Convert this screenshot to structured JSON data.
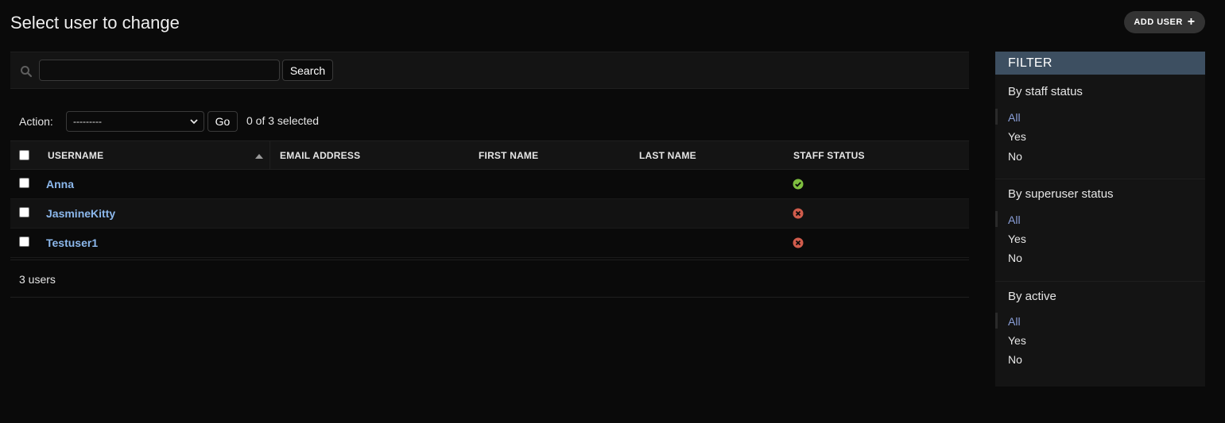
{
  "page": {
    "title": "Select user to change"
  },
  "toolbar": {
    "add_user_label": "ADD USER",
    "add_icon": "+"
  },
  "search": {
    "value": "",
    "placeholder": "",
    "button_label": "Search"
  },
  "actions": {
    "label": "Action:",
    "selected_option": "---------",
    "go_label": "Go",
    "selection_counter": "0 of 3 selected"
  },
  "table": {
    "columns": [
      "USERNAME",
      "EMAIL ADDRESS",
      "FIRST NAME",
      "LAST NAME",
      "STAFF STATUS"
    ],
    "sort_column": "USERNAME",
    "sort_direction": "ascending",
    "rows": [
      {
        "username": "Anna",
        "email": "",
        "first_name": "",
        "last_name": "",
        "staff_status": true,
        "status_icon": "check-circle-icon"
      },
      {
        "username": "JasmineKitty",
        "email": "",
        "first_name": "",
        "last_name": "",
        "staff_status": false,
        "status_icon": "x-circle-icon"
      },
      {
        "username": "Testuser1",
        "email": "",
        "first_name": "",
        "last_name": "",
        "staff_status": false,
        "status_icon": "x-circle-icon"
      }
    ]
  },
  "paginator": {
    "count_text": "3 users"
  },
  "filter": {
    "title": "FILTER",
    "sections": [
      {
        "title": "By staff status",
        "options": [
          "All",
          "Yes",
          "No"
        ],
        "selected": "All"
      },
      {
        "title": "By superuser status",
        "options": [
          "All",
          "Yes",
          "No"
        ],
        "selected": "All"
      },
      {
        "title": "By active",
        "options": [
          "All",
          "Yes",
          "No"
        ],
        "selected": "All"
      }
    ]
  },
  "colors": {
    "background": "#0a0a0a",
    "link": "#8cb8ec",
    "filter_header": "#3d4f61",
    "selected_filter": "#8a9fd8",
    "status_yes": "#7fbf3f",
    "status_no": "#d05c4c"
  }
}
